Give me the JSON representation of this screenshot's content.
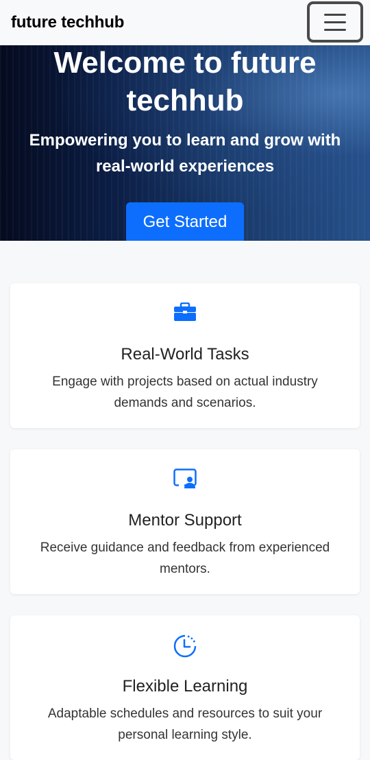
{
  "navbar": {
    "brand": "future techhub",
    "menu_icon": "hamburger-menu-icon"
  },
  "hero": {
    "title": "Welcome to future techhub",
    "subtitle": "Empowering you to learn and grow with real-world experiences",
    "cta_label": "Get Started"
  },
  "features": [
    {
      "icon": "briefcase-icon",
      "title": "Real-World Tasks",
      "description": "Engage with projects based on actual industry demands and scenarios."
    },
    {
      "icon": "person-video-icon",
      "title": "Mentor Support",
      "description": "Receive guidance and feedback from experienced mentors."
    },
    {
      "icon": "clock-history-icon",
      "title": "Flexible Learning",
      "description": "Adaptable schedules and resources to suit your personal learning style."
    }
  ],
  "colors": {
    "accent": "#0d6efd",
    "navbar_bg": "#f8f9fa",
    "page_bg": "#f7f8fa"
  }
}
